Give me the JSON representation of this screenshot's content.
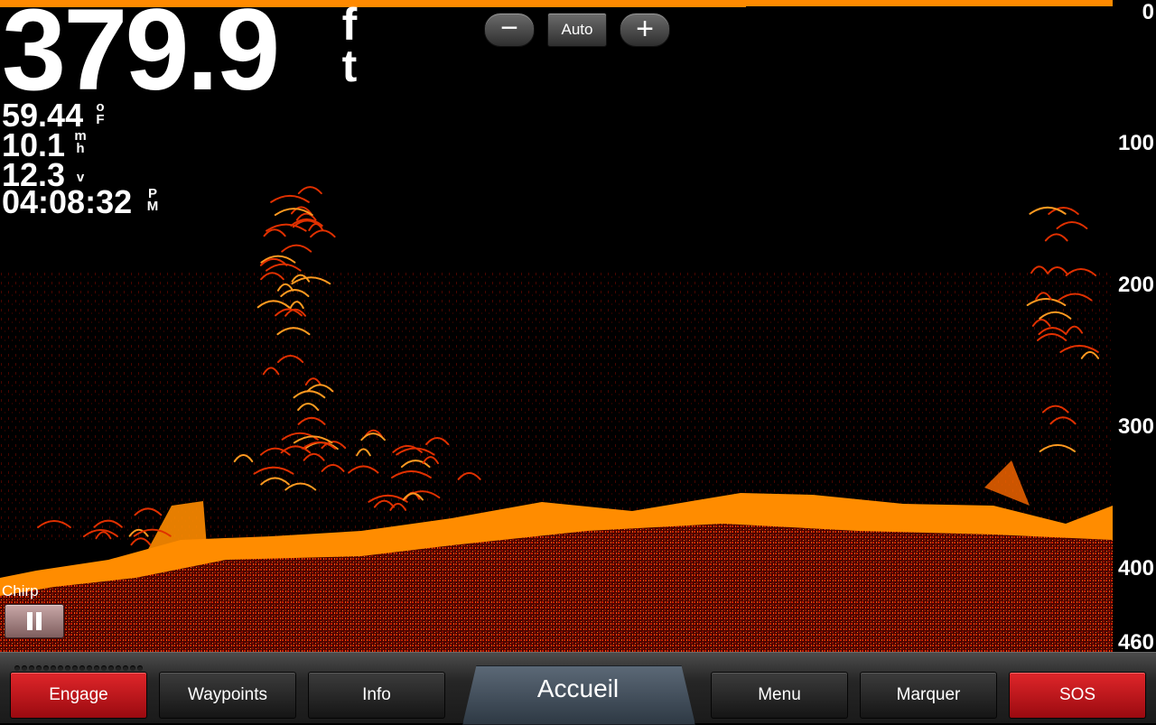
{
  "readouts": {
    "depth_value": "379.9",
    "depth_unit_top": "f",
    "depth_unit_bottom": "t",
    "water_temp_value": "59.44",
    "water_temp_unit_top": "o",
    "water_temp_unit_bottom": "F",
    "speed_value": "10.1",
    "speed_unit_top": "m",
    "speed_unit_bottom": "h",
    "voltage_value": "12.3",
    "voltage_unit": "v",
    "time_value": "04:08:32",
    "time_unit_top": "P",
    "time_unit_bottom": "M"
  },
  "zoom": {
    "minus_label": "−",
    "mode_label": "Auto",
    "plus_label": "+"
  },
  "depth_scale": {
    "ticks": [
      "0",
      "100",
      "200",
      "300",
      "400",
      "460"
    ]
  },
  "sonar": {
    "frequency_label": "Chirp",
    "pause_icon": "pause-icon",
    "colors": {
      "bottom": "#ff8c00",
      "returns": "#ff4a00",
      "clutter": "#a01000",
      "background": "#000000"
    }
  },
  "nav": {
    "engage": "Engage",
    "waypoints": "Waypoints",
    "info": "Info",
    "home": "Accueil",
    "menu": "Menu",
    "mark": "Marquer",
    "sos": "SOS"
  }
}
